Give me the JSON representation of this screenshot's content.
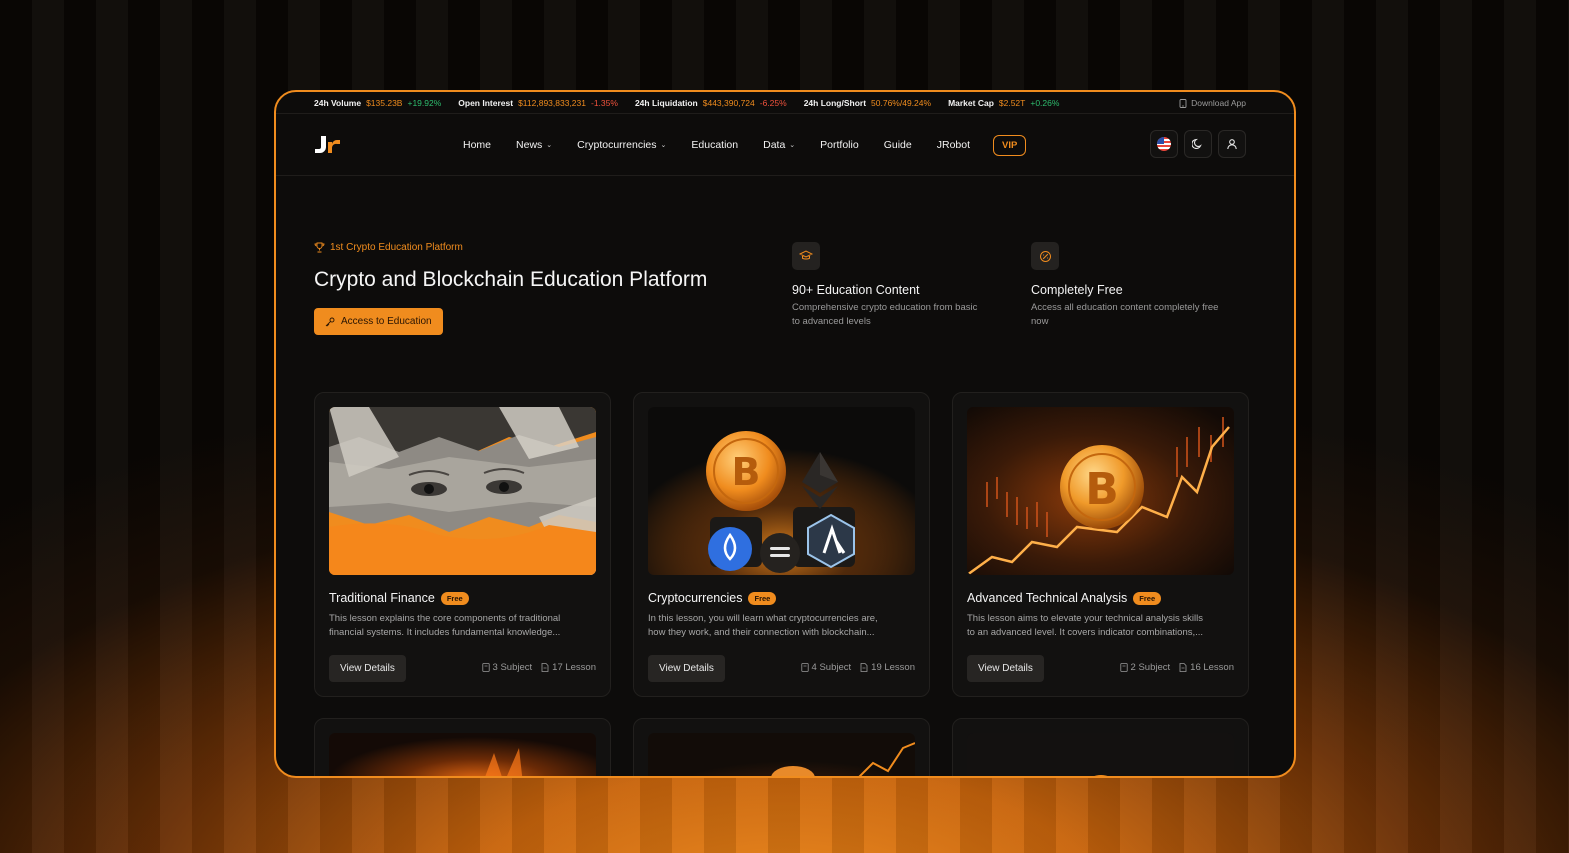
{
  "ticker": [
    {
      "label": "24h Volume",
      "value": "$135.23B",
      "change": "+19.92%",
      "dir": "up"
    },
    {
      "label": "Open Interest",
      "value": "$112,893,833,231",
      "change": "-1.35%",
      "dir": "down"
    },
    {
      "label": "24h Liquidation",
      "value": "$443,390,724",
      "change": "-6.25%",
      "dir": "down"
    },
    {
      "label": "24h Long/Short",
      "value": "50.76%/49.24%",
      "change": "",
      "dir": ""
    },
    {
      "label": "Market Cap",
      "value": "$2.52T",
      "change": "+0.26%",
      "dir": "up"
    }
  ],
  "download_app": "Download App",
  "nav": {
    "home": "Home",
    "news": "News",
    "cryptocurrencies": "Cryptocurrencies",
    "education": "Education",
    "data": "Data",
    "portfolio": "Portfolio",
    "guide": "Guide",
    "jrobot": "JRobot",
    "vip": "VIP"
  },
  "hero": {
    "badge": "1st Crypto Education Platform",
    "title": "Crypto and Blockchain Education Platform",
    "cta": "Access to Education"
  },
  "features": [
    {
      "title": "90+ Education Content",
      "line1": "Comprehensive crypto education from basic",
      "line2": "to advanced levels",
      "icon": "graduation-cap-icon"
    },
    {
      "title": "Completely Free",
      "line1": "Access all education content completely free",
      "line2": "now",
      "icon": "free-badge-icon"
    }
  ],
  "cards": [
    {
      "title": "Traditional Finance",
      "badge": "Free",
      "desc1": "This lesson explains the core components of traditional",
      "desc2": "financial systems. It includes fundamental knowledge...",
      "button": "View Details",
      "subjects": "3 Subject",
      "lessons": "17 Lesson"
    },
    {
      "title": "Cryptocurrencies",
      "badge": "Free",
      "desc1": "In this lesson, you will learn what cryptocurrencies are,",
      "desc2": "how they work, and their connection with blockchain...",
      "button": "View Details",
      "subjects": "4 Subject",
      "lessons": "19 Lesson"
    },
    {
      "title": "Advanced Technical Analysis",
      "badge": "Free",
      "desc1": "This lesson aims to elevate your technical analysis skills",
      "desc2": "to an advanced level. It covers indicator combinations,...",
      "button": "View Details",
      "subjects": "2 Subject",
      "lessons": "16 Lesson"
    }
  ],
  "colors": {
    "accent": "#f08c1e",
    "up": "#2ebd6e",
    "down": "#f0523c",
    "panel": "#0d0c0b"
  }
}
